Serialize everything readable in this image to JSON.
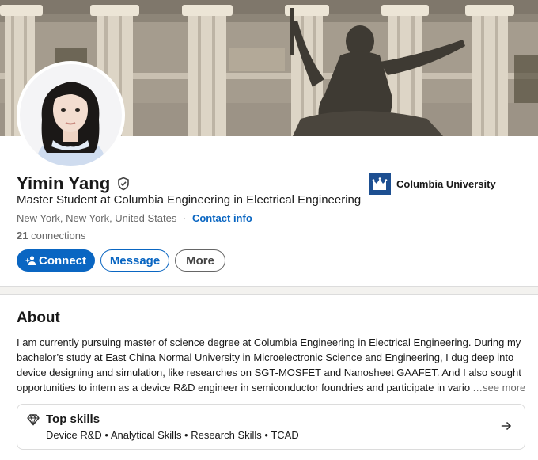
{
  "profile": {
    "name": "Yimin Yang",
    "headline": "Master Student at Columbia Engineering in Electrical Engineering",
    "location": "New York, New York, United States",
    "location_sep": "·",
    "contact_label": "Contact info",
    "connections_count": "21",
    "connections_label": "connections",
    "verified_icon": "verified-shield-icon"
  },
  "actions": {
    "connect_label": "Connect",
    "connect_icon": "add-person-icon",
    "message_label": "Message",
    "more_label": "More"
  },
  "education": {
    "school_name": "Columbia University",
    "logo_icon": "crown-logo",
    "logo_color": "#1d4f91"
  },
  "about": {
    "title": "About",
    "lines": [
      "I am currently pursuing master of science degree at Columbia Engineering in Electrical Engineering. During my",
      "bachelor’s study at East China Normal University in Microelectronic Science and Engineering, I dug deep into",
      "device designing and simulation, like researches on SGT-MOSFET and Nanosheet GAAFET. And I also sought",
      "opportunities to intern as a device R&D engineer in semiconductor foundries and participate in vario"
    ],
    "see_more": "…see more"
  },
  "top_skills": {
    "title": "Top skills",
    "list": "Device R&D • Analytical Skills • Research Skills • TCAD",
    "icon": "diamond-icon",
    "arrow_icon": "arrow-right-icon"
  },
  "colors": {
    "accent": "#0a66c2",
    "background": "#f3f2ef"
  }
}
